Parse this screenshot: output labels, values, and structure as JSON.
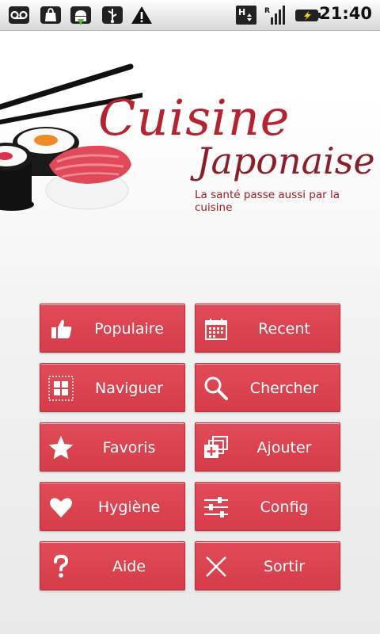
{
  "status_bar": {
    "time": "21:40",
    "icons": [
      "voicemail-icon",
      "bag-icon",
      "android-download-icon",
      "usb-icon",
      "warning-icon",
      "hspa-icon",
      "roaming-signal-icon",
      "battery-charging-icon"
    ]
  },
  "header": {
    "title_line1": "Cuisine",
    "title_line2": "Japonaise",
    "tagline": "La santé passe aussi par la cuisine"
  },
  "menu": {
    "items": [
      {
        "label": "Populaire",
        "icon": "thumbs-up-icon"
      },
      {
        "label": "Recent",
        "icon": "calendar-icon"
      },
      {
        "label": "Naviguer",
        "icon": "grid-icon"
      },
      {
        "label": "Chercher",
        "icon": "search-icon"
      },
      {
        "label": "Favoris",
        "icon": "star-icon"
      },
      {
        "label": "Ajouter",
        "icon": "add-icon"
      },
      {
        "label": "Hygiène",
        "icon": "heart-icon"
      },
      {
        "label": "Config",
        "icon": "sliders-icon"
      },
      {
        "label": "Aide",
        "icon": "question-icon"
      },
      {
        "label": "Sortir",
        "icon": "close-icon"
      }
    ]
  },
  "colors": {
    "button": "#dc4250",
    "title": "#b32430"
  }
}
